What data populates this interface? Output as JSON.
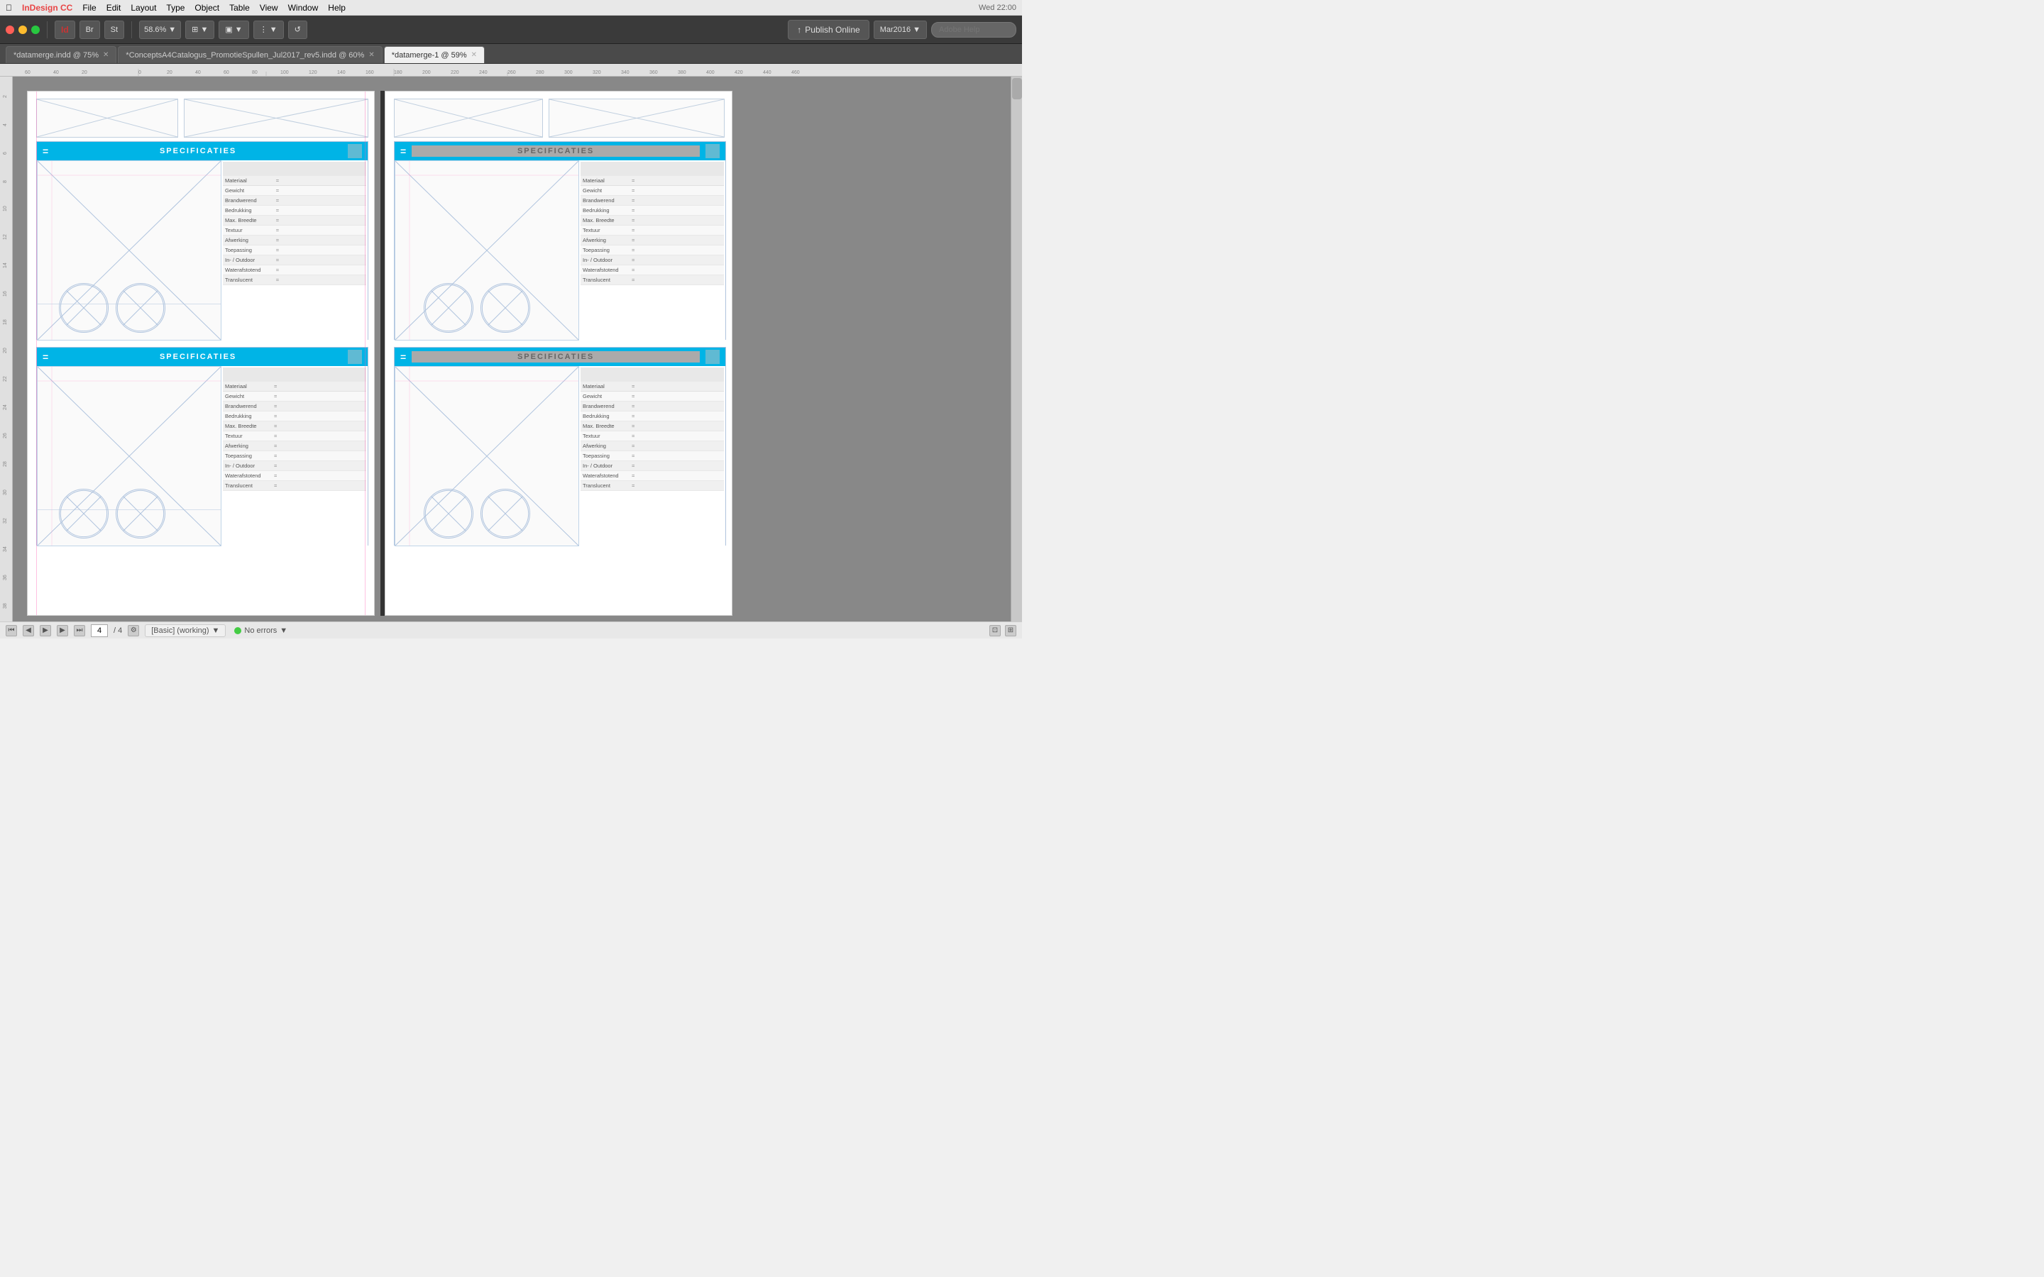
{
  "menubar": {
    "apple": "⌘",
    "app_name": "InDesign CC",
    "menus": [
      "File",
      "Edit",
      "Layout",
      "Type",
      "Object",
      "Table",
      "View",
      "Window",
      "Help"
    ]
  },
  "toolbar": {
    "zoom_level": "58.6%",
    "publish_label": "Publish Online",
    "date_label": "Mar2016",
    "search_placeholder": "Adobe Help"
  },
  "tabs": [
    {
      "label": "*datamerge.indd @ 75%",
      "active": false
    },
    {
      "label": "*ConceptsA4Catalogus_PromotieSpullen_Jul2017_rev5.indd @ 60%",
      "active": false
    },
    {
      "label": "*datamerge-1 @ 59%",
      "active": true
    }
  ],
  "statusbar": {
    "page_current": "4",
    "page_total": "4",
    "style_label": "[Basic] (working)",
    "error_label": "No errors"
  },
  "cards": {
    "spec_rows": [
      "Materiaal",
      "Gewicht",
      "Brandwerend",
      "Bedrukking",
      "Max. Breedte",
      "Textuur",
      "Afwerking",
      "Toepassing",
      "In- / Outdoor",
      "Waterafstotend",
      "Translucent"
    ],
    "spec_title": "SPECIFICATIES",
    "equals_symbol": "="
  },
  "colors": {
    "header_blue": "#00b4e6",
    "ruler_bg": "#e0e0e0",
    "canvas_bg": "#888888",
    "card_border": "#b0c4de",
    "toolbar_bg": "#3a3a3a"
  }
}
